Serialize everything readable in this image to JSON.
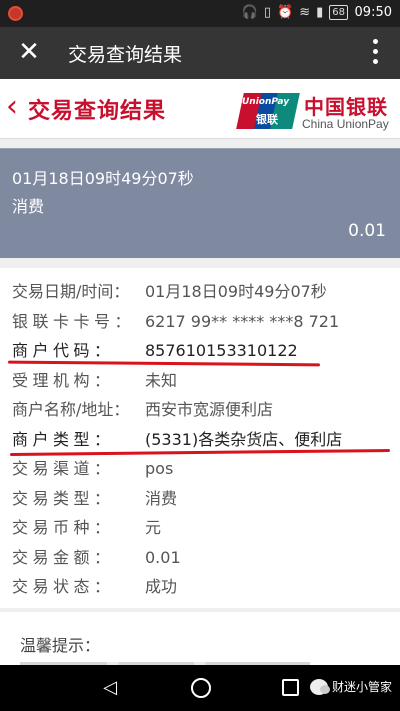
{
  "statusbar": {
    "battery": "68",
    "time": "09:50"
  },
  "topbar": {
    "title": "交易查询结果",
    "close_glyph": "✕"
  },
  "header": {
    "back_glyph": "‹",
    "title": "交易查询结果",
    "logo_en_top": "UnionPay",
    "logo_cn_small": "银联",
    "brand_cn": "中国银联",
    "brand_en": "China UnionPay"
  },
  "summary": {
    "time": "01月18日09时49分07秒",
    "type": "消费",
    "amount": "0.01"
  },
  "details": [
    {
      "label": "交易日期/时间：",
      "value": "01月18日09时49分07秒",
      "wide": false
    },
    {
      "label": "银联卡卡号：",
      "value": "6217 99** **** ***8 721",
      "wide": true
    },
    {
      "label": "商户代码：",
      "value": "857610153310122",
      "wide": true
    },
    {
      "label": "受理机构：",
      "value": "未知",
      "wide": true
    },
    {
      "label": "商户名称/地址：",
      "value": "西安市宽源便利店",
      "wide": false
    },
    {
      "label": "商户类型：",
      "value": "(5331)各类杂货店、便利店",
      "wide": true
    },
    {
      "label": "交易渠道：",
      "value": "pos",
      "wide": true
    },
    {
      "label": "交易类型：",
      "value": "消费",
      "wide": true
    },
    {
      "label": "交易币种：",
      "value": "元",
      "wide": true
    },
    {
      "label": "交易金额：",
      "value": "0.01",
      "wide": true
    },
    {
      "label": "交易状态：",
      "value": "成功",
      "wide": true
    }
  ],
  "tips": {
    "title": "温馨提示："
  },
  "navbar": {
    "back_glyph": "◁",
    "watermark": "财迷小管家"
  },
  "colors": {
    "unionpay_red": "#c8102e",
    "summary_bg": "#7f8aa1",
    "underline": "#d9131b"
  }
}
